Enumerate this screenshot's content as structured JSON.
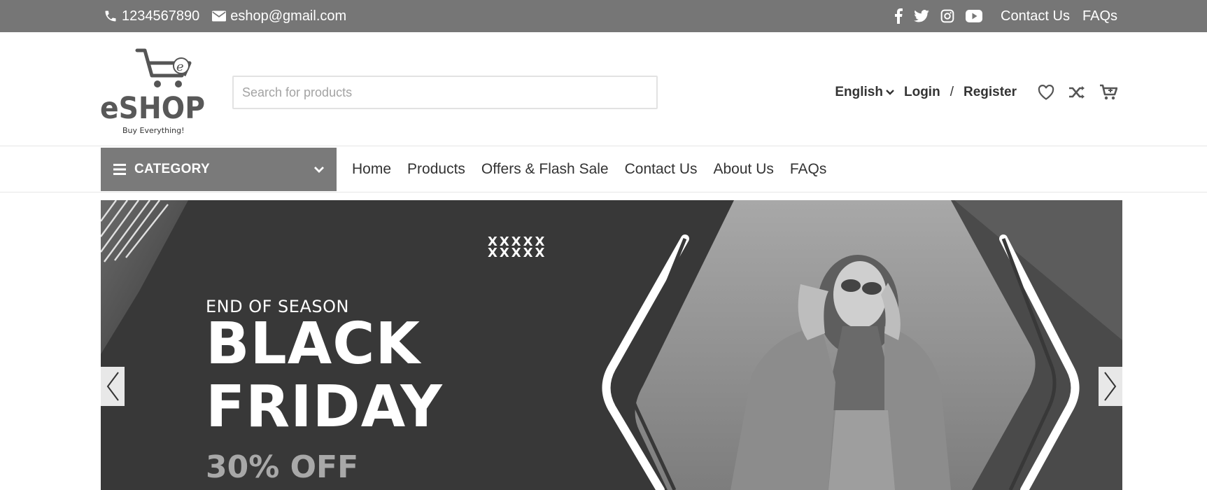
{
  "topbar": {
    "phone": "1234567890",
    "email": "eshop@gmail.com",
    "social_icons": [
      "facebook-icon",
      "twitter-icon",
      "instagram-icon",
      "youtube-icon"
    ],
    "contact_link": "Contact Us",
    "faqs_link": "FAQs"
  },
  "header": {
    "logo_text": "eSHOP",
    "logo_tagline": "Buy Everything!",
    "search_placeholder": "Search for products",
    "language": "English",
    "login": "Login",
    "separator": "/",
    "register": "Register",
    "icons": [
      "heart-icon",
      "shuffle-icon",
      "cart-icon"
    ]
  },
  "nav": {
    "category_label": "CATEGORY",
    "links": [
      "Home",
      "Products",
      "Offers & Flash Sale",
      "Contact Us",
      "About Us",
      "FAQs"
    ]
  },
  "banner": {
    "eyebrow": "END OF SEASON",
    "title_line1": "BLACK",
    "title_line2": "FRIDAY",
    "discount": "30% OFF",
    "decoration": "XXXXX"
  },
  "colors": {
    "topbar_bg": "#767676",
    "category_bg": "#7a7a7a",
    "banner_bg": "#383838"
  }
}
